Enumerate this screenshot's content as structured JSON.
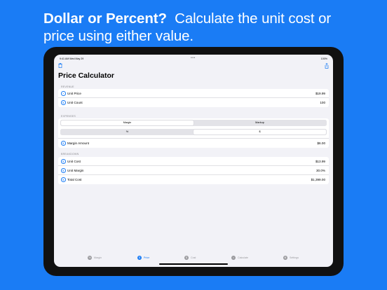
{
  "headline": {
    "bold": "Dollar or Percent?",
    "rest": "Calculate the unit cost or price using either value."
  },
  "status": {
    "time": "9:41 AM Wed May 29",
    "battery": "100%"
  },
  "page_title": "Price Calculator",
  "revenue": {
    "label": "REVENUE",
    "rows": [
      {
        "label": "Unit Price",
        "value": "$19.99"
      },
      {
        "label": "Unit Count",
        "value": "100"
      }
    ]
  },
  "expenses": {
    "label": "EXPENSES",
    "seg1": [
      "Margin",
      "Markup"
    ],
    "seg2": [
      "%",
      "$"
    ],
    "row": {
      "label": "Margin Amount",
      "value": "$6.00"
    }
  },
  "breakdown": {
    "label": "BREAKDOWN",
    "rows": [
      {
        "label": "Unit Cost",
        "value": "$13.99"
      },
      {
        "label": "Unit Margin",
        "value": "30.0%"
      },
      {
        "label": "Total Cost",
        "value": "$1,399.00"
      }
    ]
  },
  "tabs": [
    "Margin",
    "Price",
    "Cost",
    "Calculate",
    "Settings"
  ],
  "colors": {
    "accent": "#1a7cf5",
    "background": "#1a7cf5"
  },
  "icons": {
    "trash": "trash-icon",
    "share": "share-icon"
  }
}
